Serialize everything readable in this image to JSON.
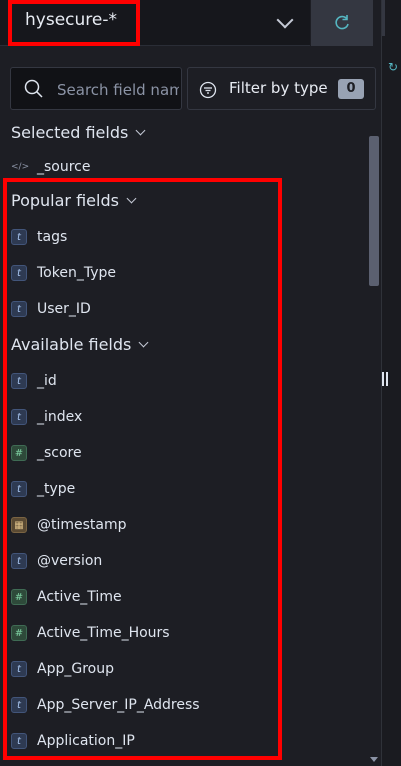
{
  "index_pattern": {
    "selected": "hysecure-*"
  },
  "search": {
    "placeholder": "Search field names"
  },
  "filter": {
    "label": "Filter by type",
    "count": "0"
  },
  "sections": {
    "selected": {
      "title": "Selected fields",
      "items": [
        {
          "name": "_source",
          "type": "source"
        }
      ]
    },
    "popular": {
      "title": "Popular fields",
      "items": [
        {
          "name": "tags",
          "type": "string"
        },
        {
          "name": "Token_Type",
          "type": "string"
        },
        {
          "name": "User_ID",
          "type": "string"
        }
      ]
    },
    "available": {
      "title": "Available fields",
      "items": [
        {
          "name": "_id",
          "type": "string"
        },
        {
          "name": "_index",
          "type": "string"
        },
        {
          "name": "_score",
          "type": "number"
        },
        {
          "name": "_type",
          "type": "string"
        },
        {
          "name": "@timestamp",
          "type": "date"
        },
        {
          "name": "@version",
          "type": "string"
        },
        {
          "name": "Active_Time",
          "type": "number"
        },
        {
          "name": "Active_Time_Hours",
          "type": "number"
        },
        {
          "name": "App_Group",
          "type": "string"
        },
        {
          "name": "App_Server_IP_Address",
          "type": "string"
        },
        {
          "name": "Application_IP",
          "type": "string"
        }
      ]
    }
  },
  "type_glyphs": {
    "string": "t",
    "number": "#",
    "date": "▦",
    "source": "</>"
  },
  "colors": {
    "highlight": "#ff0000",
    "accent": "#55b6c1"
  }
}
